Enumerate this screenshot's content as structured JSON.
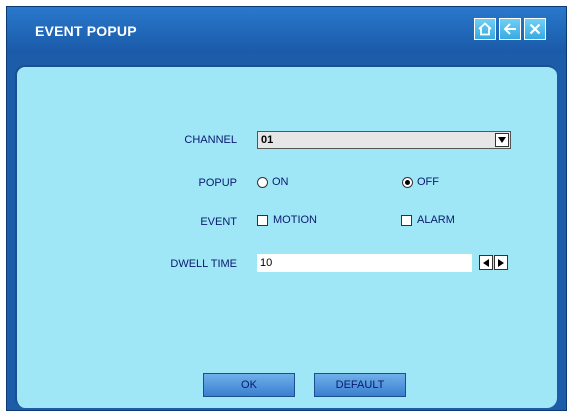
{
  "title": "EVENT POPUP",
  "titlebar_icons": [
    "home-icon",
    "back-arrow-icon",
    "close-icon"
  ],
  "form": {
    "channel_label": "CHANNEL",
    "channel_value": "01",
    "popup_label": "POPUP",
    "popup_on": "ON",
    "popup_off": "OFF",
    "popup_selected": "OFF",
    "event_label": "EVENT",
    "event_motion": "MOTION",
    "event_alarm": "ALARM",
    "event_motion_checked": false,
    "event_alarm_checked": false,
    "dwell_label": "DWELL TIME",
    "dwell_value": "10"
  },
  "buttons": {
    "ok": "OK",
    "default": "DEFAULT"
  },
  "colors": {
    "titlebar": "#1c5ca8",
    "panel": "#9fe7f6",
    "label_text": "#0a1a6e",
    "title_text": "#ffffff"
  }
}
